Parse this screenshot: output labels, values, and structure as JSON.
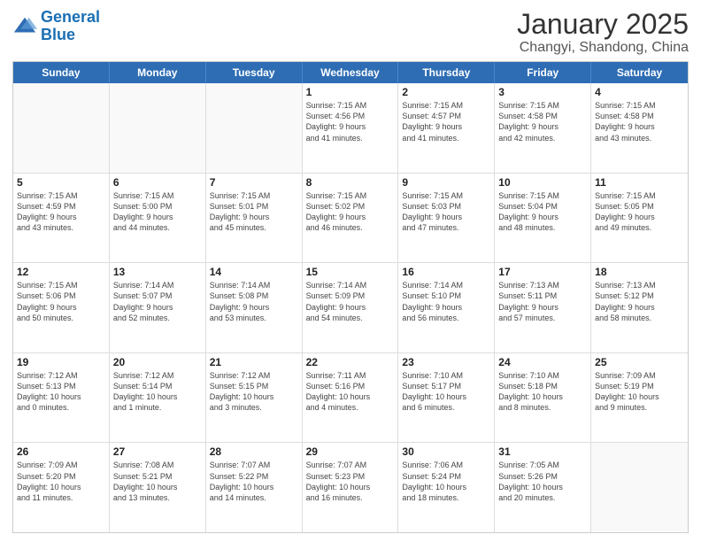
{
  "header": {
    "logo_line1": "General",
    "logo_line2": "Blue",
    "month": "January 2025",
    "location": "Changyi, Shandong, China"
  },
  "days": [
    "Sunday",
    "Monday",
    "Tuesday",
    "Wednesday",
    "Thursday",
    "Friday",
    "Saturday"
  ],
  "weeks": [
    [
      {
        "date": "",
        "info": ""
      },
      {
        "date": "",
        "info": ""
      },
      {
        "date": "",
        "info": ""
      },
      {
        "date": "1",
        "info": "Sunrise: 7:15 AM\nSunset: 4:56 PM\nDaylight: 9 hours\nand 41 minutes."
      },
      {
        "date": "2",
        "info": "Sunrise: 7:15 AM\nSunset: 4:57 PM\nDaylight: 9 hours\nand 41 minutes."
      },
      {
        "date": "3",
        "info": "Sunrise: 7:15 AM\nSunset: 4:58 PM\nDaylight: 9 hours\nand 42 minutes."
      },
      {
        "date": "4",
        "info": "Sunrise: 7:15 AM\nSunset: 4:58 PM\nDaylight: 9 hours\nand 43 minutes."
      }
    ],
    [
      {
        "date": "5",
        "info": "Sunrise: 7:15 AM\nSunset: 4:59 PM\nDaylight: 9 hours\nand 43 minutes."
      },
      {
        "date": "6",
        "info": "Sunrise: 7:15 AM\nSunset: 5:00 PM\nDaylight: 9 hours\nand 44 minutes."
      },
      {
        "date": "7",
        "info": "Sunrise: 7:15 AM\nSunset: 5:01 PM\nDaylight: 9 hours\nand 45 minutes."
      },
      {
        "date": "8",
        "info": "Sunrise: 7:15 AM\nSunset: 5:02 PM\nDaylight: 9 hours\nand 46 minutes."
      },
      {
        "date": "9",
        "info": "Sunrise: 7:15 AM\nSunset: 5:03 PM\nDaylight: 9 hours\nand 47 minutes."
      },
      {
        "date": "10",
        "info": "Sunrise: 7:15 AM\nSunset: 5:04 PM\nDaylight: 9 hours\nand 48 minutes."
      },
      {
        "date": "11",
        "info": "Sunrise: 7:15 AM\nSunset: 5:05 PM\nDaylight: 9 hours\nand 49 minutes."
      }
    ],
    [
      {
        "date": "12",
        "info": "Sunrise: 7:15 AM\nSunset: 5:06 PM\nDaylight: 9 hours\nand 50 minutes."
      },
      {
        "date": "13",
        "info": "Sunrise: 7:14 AM\nSunset: 5:07 PM\nDaylight: 9 hours\nand 52 minutes."
      },
      {
        "date": "14",
        "info": "Sunrise: 7:14 AM\nSunset: 5:08 PM\nDaylight: 9 hours\nand 53 minutes."
      },
      {
        "date": "15",
        "info": "Sunrise: 7:14 AM\nSunset: 5:09 PM\nDaylight: 9 hours\nand 54 minutes."
      },
      {
        "date": "16",
        "info": "Sunrise: 7:14 AM\nSunset: 5:10 PM\nDaylight: 9 hours\nand 56 minutes."
      },
      {
        "date": "17",
        "info": "Sunrise: 7:13 AM\nSunset: 5:11 PM\nDaylight: 9 hours\nand 57 minutes."
      },
      {
        "date": "18",
        "info": "Sunrise: 7:13 AM\nSunset: 5:12 PM\nDaylight: 9 hours\nand 58 minutes."
      }
    ],
    [
      {
        "date": "19",
        "info": "Sunrise: 7:12 AM\nSunset: 5:13 PM\nDaylight: 10 hours\nand 0 minutes."
      },
      {
        "date": "20",
        "info": "Sunrise: 7:12 AM\nSunset: 5:14 PM\nDaylight: 10 hours\nand 1 minute."
      },
      {
        "date": "21",
        "info": "Sunrise: 7:12 AM\nSunset: 5:15 PM\nDaylight: 10 hours\nand 3 minutes."
      },
      {
        "date": "22",
        "info": "Sunrise: 7:11 AM\nSunset: 5:16 PM\nDaylight: 10 hours\nand 4 minutes."
      },
      {
        "date": "23",
        "info": "Sunrise: 7:10 AM\nSunset: 5:17 PM\nDaylight: 10 hours\nand 6 minutes."
      },
      {
        "date": "24",
        "info": "Sunrise: 7:10 AM\nSunset: 5:18 PM\nDaylight: 10 hours\nand 8 minutes."
      },
      {
        "date": "25",
        "info": "Sunrise: 7:09 AM\nSunset: 5:19 PM\nDaylight: 10 hours\nand 9 minutes."
      }
    ],
    [
      {
        "date": "26",
        "info": "Sunrise: 7:09 AM\nSunset: 5:20 PM\nDaylight: 10 hours\nand 11 minutes."
      },
      {
        "date": "27",
        "info": "Sunrise: 7:08 AM\nSunset: 5:21 PM\nDaylight: 10 hours\nand 13 minutes."
      },
      {
        "date": "28",
        "info": "Sunrise: 7:07 AM\nSunset: 5:22 PM\nDaylight: 10 hours\nand 14 minutes."
      },
      {
        "date": "29",
        "info": "Sunrise: 7:07 AM\nSunset: 5:23 PM\nDaylight: 10 hours\nand 16 minutes."
      },
      {
        "date": "30",
        "info": "Sunrise: 7:06 AM\nSunset: 5:24 PM\nDaylight: 10 hours\nand 18 minutes."
      },
      {
        "date": "31",
        "info": "Sunrise: 7:05 AM\nSunset: 5:26 PM\nDaylight: 10 hours\nand 20 minutes."
      },
      {
        "date": "",
        "info": ""
      }
    ]
  ]
}
